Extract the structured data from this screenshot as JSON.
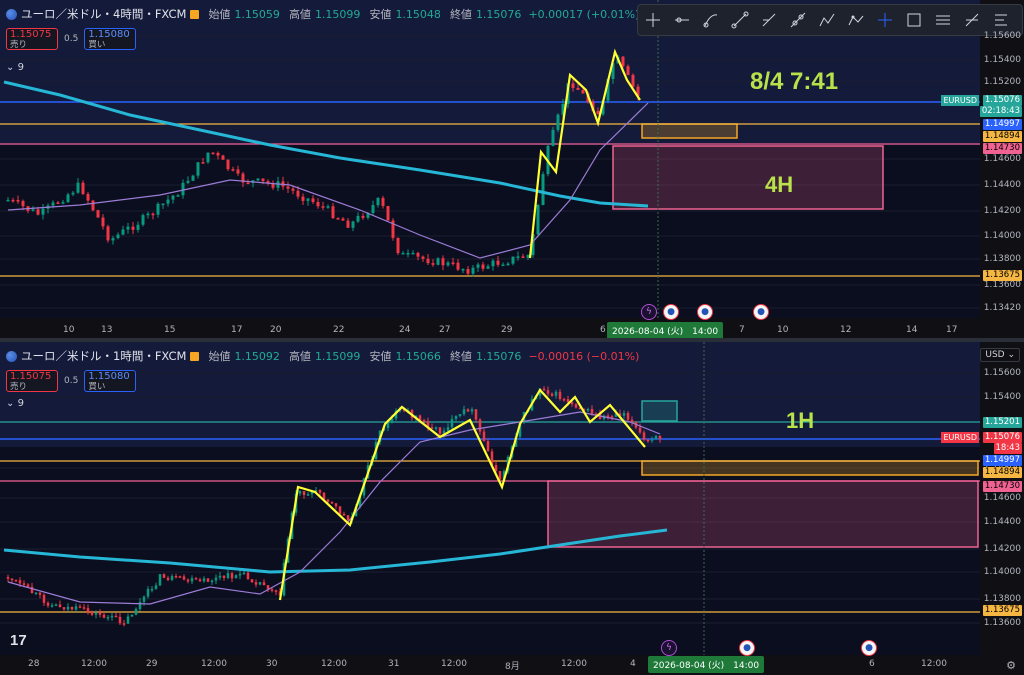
{
  "colors": {
    "bull": "#089981",
    "bear": "#f23645",
    "ma200": "#26b7d6",
    "ma20": "#9c7cd6",
    "zigzag": "#ffff33"
  },
  "top": {
    "symbol_title": "ユーロ／米ドル・4時間・FXCM",
    "o_label": "始値",
    "o_val": "1.15059",
    "h_label": "高値",
    "h_val": "1.15099",
    "l_label": "安値",
    "l_val": "1.15048",
    "c_label": "終値",
    "c_val": "1.15076",
    "change": "+0.00017 (+0.01%)",
    "sell_price": "1.15075",
    "sell_label": "売り",
    "spread": "0.5",
    "buy_price": "1.15080",
    "buy_label": "買い",
    "indicator_count": "9",
    "annotation_time": "8/4 7:41",
    "annotation_tf": "4H",
    "y_ticks": [
      "1.15600",
      "1.15400",
      "1.15200",
      "1.14800",
      "1.14600",
      "1.14400",
      "1.14200",
      "1.14000",
      "1.13800",
      "1.13600",
      "1.13420"
    ],
    "price_labels": [
      {
        "text": "1.15076",
        "bg": "#26a69a",
        "fg": "#ffffff"
      },
      {
        "text": "02:18:43",
        "bg": "#26a69a",
        "fg": "#ffffff"
      },
      {
        "text": "1.14997",
        "bg": "#2962ff",
        "fg": "#ffffff"
      },
      {
        "text": "1.14894",
        "bg": "#f5b642",
        "fg": "#000000"
      },
      {
        "text": "1.14730",
        "bg": "#f06292",
        "fg": "#000000"
      },
      {
        "text": "1.13675",
        "bg": "#f5b642",
        "fg": "#000000"
      }
    ],
    "symbol_tag": "EURUSD",
    "x_ticks": [
      "10",
      "13",
      "15",
      "17",
      "20",
      "22",
      "24",
      "27",
      "29",
      "6",
      "7",
      "10",
      "12",
      "14",
      "17"
    ],
    "x_badge": "2026-08-04 (火)　14:00"
  },
  "bottom": {
    "symbol_title": "ユーロ／米ドル・1時間・FXCM",
    "o_label": "始値",
    "o_val": "1.15092",
    "h_label": "高値",
    "h_val": "1.15099",
    "l_label": "安値",
    "l_val": "1.15066",
    "c_label": "終値",
    "c_val": "1.15076",
    "change": "−0.00016 (−0.01%)",
    "sell_price": "1.15075",
    "sell_label": "売り",
    "spread": "0.5",
    "buy_price": "1.15080",
    "buy_label": "買い",
    "indicator_count": "9",
    "annotation_tf": "1H",
    "currency": "USD",
    "y_ticks": [
      "1.15600",
      "1.15400",
      "1.14800",
      "1.14600",
      "1.14400",
      "1.14200",
      "1.14000",
      "1.13800",
      "1.13600"
    ],
    "price_labels": [
      {
        "text": "1.15201",
        "bg": "#26a69a",
        "fg": "#ffffff"
      },
      {
        "text": "1.15076",
        "bg": "#f23645",
        "fg": "#ffffff"
      },
      {
        "text": "18:43",
        "bg": "#f23645",
        "fg": "#ffffff"
      },
      {
        "text": "1.14997",
        "bg": "#2962ff",
        "fg": "#ffffff"
      },
      {
        "text": "1.14894",
        "bg": "#f5b642",
        "fg": "#000000"
      },
      {
        "text": "1.14730",
        "bg": "#f06292",
        "fg": "#000000"
      },
      {
        "text": "1.13675",
        "bg": "#f5b642",
        "fg": "#000000"
      }
    ],
    "symbol_tag": "EURUSD",
    "x_ticks": [
      "28",
      "12:00",
      "29",
      "12:00",
      "30",
      "12:00",
      "31",
      "12:00",
      "8月",
      "12:00",
      "4",
      "12:00",
      "6",
      "12:00"
    ],
    "x_badge": "2026-08-04 (火)　14:00",
    "tv_logo": "17"
  },
  "toolbar": {
    "tools": [
      "crosshair-icon",
      "horizontal-ray-icon",
      "brush-icon",
      "trend-line-icon",
      "info-line-icon",
      "extended-line-icon",
      "path-icon",
      "polyline-icon",
      "cross-line-icon",
      "rectangle-icon",
      "pitchfork-icon",
      "fib-icon",
      "text-list-icon"
    ]
  }
}
